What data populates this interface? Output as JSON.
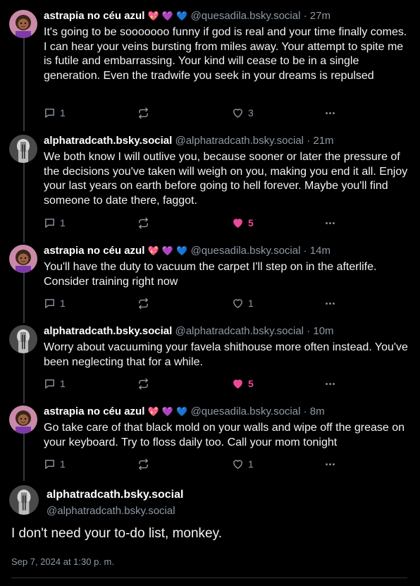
{
  "replies": [
    {
      "author": "astrapia no céu azul",
      "emoji": "💖 💜 💙",
      "handle": "@quesadila.bsky.social",
      "time": "· 27m",
      "text": "It's going to be sooooooo funny if god is real and your time finally comes. I can hear your veins bursting from miles away. Your attempt to spite me is futile and embarrassing. Your kind will cease to be in a single generation. Even the tradwife you seek in your dreams is repulsed",
      "reply_count": "1",
      "like_count": "3",
      "liked": false
    },
    {
      "author": "alphatradcath.bsky.social",
      "emoji": "",
      "handle": "@alphatradcath.bsky.social",
      "time": "· 21m",
      "text": "We both know I will outlive you, because sooner or later the pressure of the decisions you've taken will weigh on you, making you end it all. Enjoy your last years on earth before going to hell forever. Maybe you'll find someone to date there, faggot.",
      "reply_count": "1",
      "like_count": "5",
      "liked": true
    },
    {
      "author": "astrapia no céu azul",
      "emoji": "💖 💜 💙",
      "handle": "@quesadila.bsky.social",
      "time": "· 14m",
      "text": "You'll have the duty to vacuum the carpet I'll step on in the afterlife. Consider training right now",
      "reply_count": "1",
      "like_count": "1",
      "liked": false
    },
    {
      "author": "alphatradcath.bsky.social",
      "emoji": "",
      "handle": "@alphatradcath.bsky.social",
      "time": "· 10m",
      "text": "Worry about vacuuming your favela shithouse more often instead. You've been neglecting that for a while.",
      "reply_count": "1",
      "like_count": "5",
      "liked": true
    },
    {
      "author": "astrapia no céu azul",
      "emoji": "💖 💜 💙",
      "handle": "@quesadila.bsky.social",
      "time": "· 8m",
      "text": "Go take care of that black mold on your walls and wipe off the grease on your keyboard. Try to floss daily too. Call your mom tonight",
      "reply_count": "1",
      "like_count": "1",
      "liked": false
    }
  ],
  "main_post": {
    "author": "alphatradcath.bsky.social",
    "handle": "@alphatradcath.bsky.social",
    "text": "I don't need your to-do list, monkey.",
    "timestamp": "Sep 7, 2024 at 1:30 p. m."
  },
  "colors": {
    "background": "#000000",
    "muted_text": "#8d99a6",
    "like_active": "#ec4899",
    "thread_line": "#333a42"
  },
  "icons": {
    "reply": "speech-bubble-icon",
    "repost": "repost-arrows-icon",
    "like": "heart-icon",
    "more": "ellipsis-icon"
  }
}
